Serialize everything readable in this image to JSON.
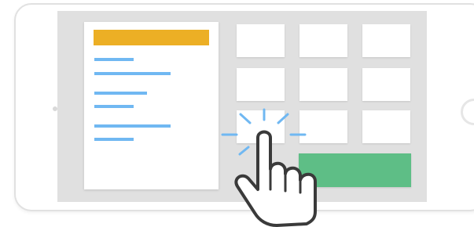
{
  "colors": {
    "screen_bg": "#e0e0e0",
    "header_bar": "#ecaf25",
    "text_lines": "#70b8f2",
    "tiles": "#ffffff",
    "action_button": "#5ebe86",
    "tap_burst": "#70b8f2"
  },
  "icons": {
    "camera": "camera-dot-icon",
    "home": "home-button-icon",
    "pointer": "pointing-hand-icon",
    "tap": "tap-burst-icon"
  },
  "panel": {
    "line_count": 6
  },
  "grid": {
    "rows": 3,
    "columns": 3
  }
}
